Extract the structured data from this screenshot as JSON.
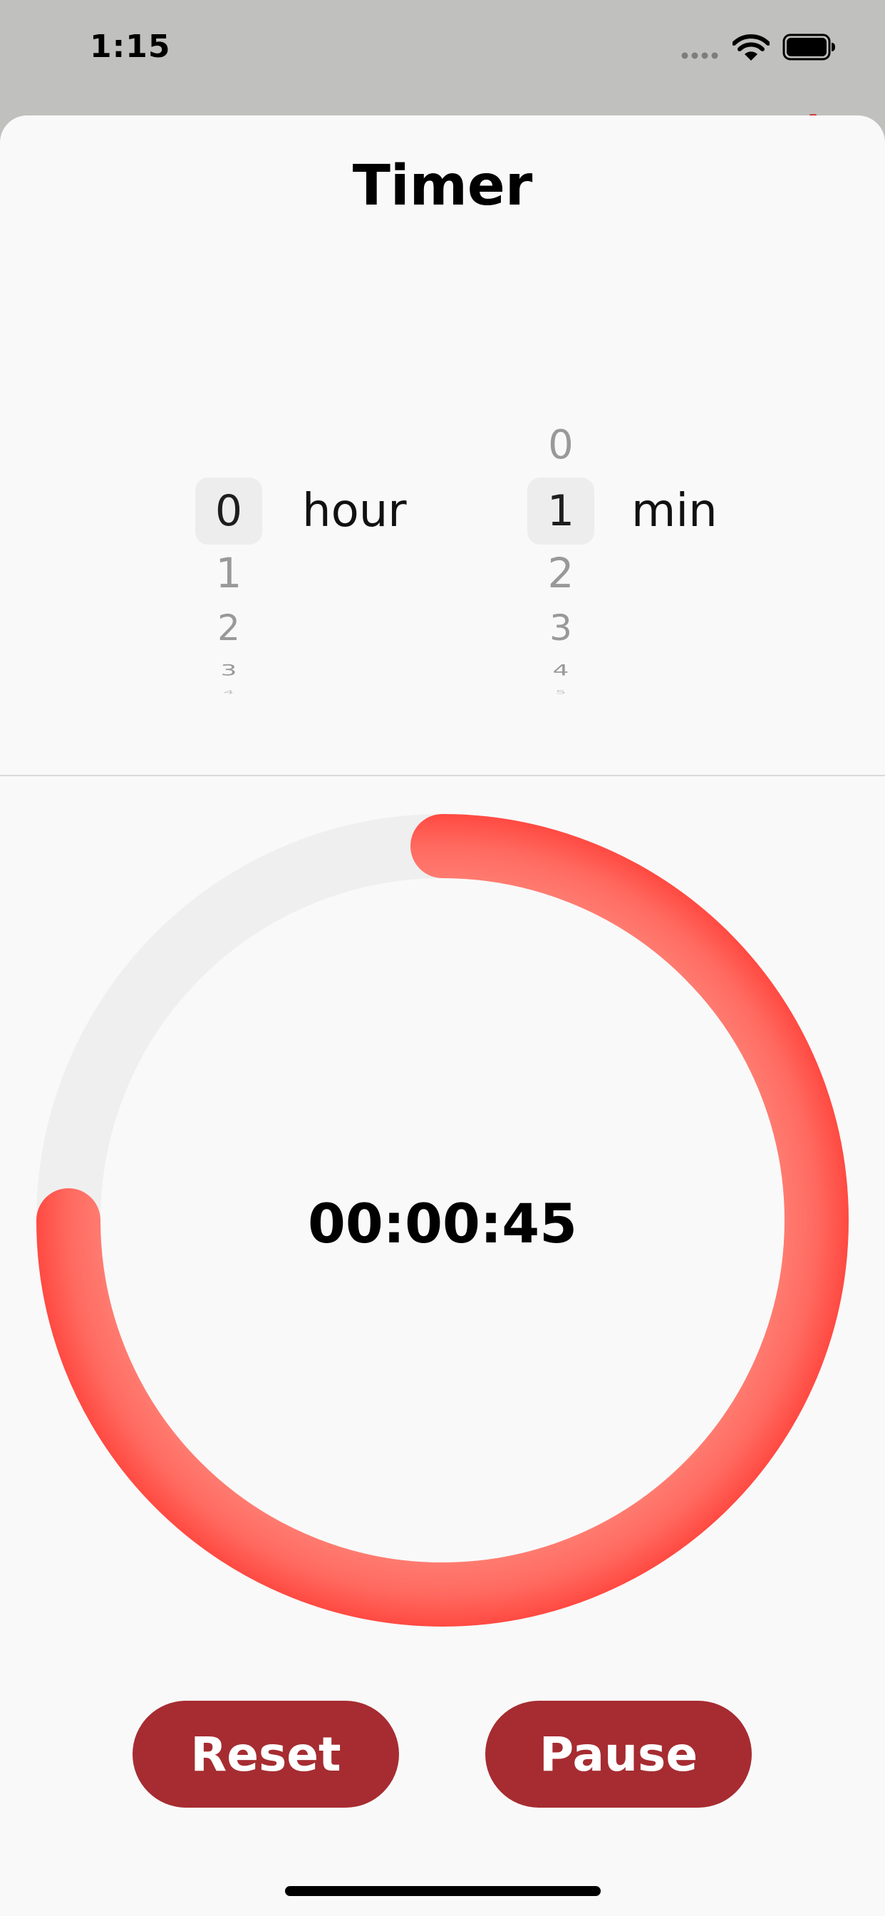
{
  "status_bar": {
    "time": "1:15"
  },
  "title": "Timer",
  "hour_picker": {
    "above": "",
    "selected": "0",
    "below": [
      "1",
      "2",
      "3",
      "4"
    ],
    "label": "hour"
  },
  "min_picker": {
    "above": "0",
    "selected": "1",
    "below": [
      "2",
      "3",
      "4",
      "5"
    ],
    "label": "min"
  },
  "countdown": {
    "display": "00:00:45",
    "progress_fraction": 0.75
  },
  "buttons": {
    "reset": "Reset",
    "pause": "Pause"
  },
  "colors": {
    "ring_track": "#efefef",
    "ring_progress_dark": "#ff4a42",
    "ring_progress_light": "#ff7b70",
    "button_bg": "#a62c31",
    "sheet_bg": "#f9f9f9"
  }
}
